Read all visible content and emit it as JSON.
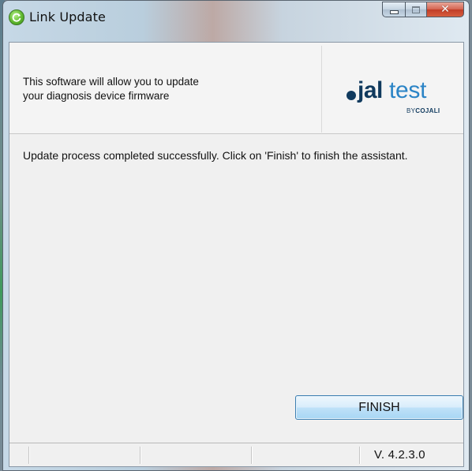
{
  "window": {
    "title": "Link Update",
    "controls": {
      "minimize": "minimize",
      "maximize": "maximize",
      "close": "close"
    }
  },
  "header": {
    "description_line1": "This software will allow you to update",
    "description_line2": "your diagnosis device firmware",
    "logo": {
      "text_bold": "jal",
      "text_light": "test",
      "sub_prefix": "BY",
      "sub_brand": "COJALI",
      "colors": {
        "dark": "#103a5e",
        "light": "#2b84c6"
      }
    }
  },
  "main": {
    "message": "Update process completed successfully. Click on 'Finish' to finish the assistant.",
    "finish_label": "FINISH"
  },
  "statusbar": {
    "version": "V. 4.2.3.0"
  },
  "icons": {
    "app": "refresh-icon",
    "minimize": "minimize-icon",
    "maximize": "maximize-icon",
    "close": "close-icon"
  },
  "colors": {
    "accent": "#3c7fb1",
    "close_button": "#c13e28",
    "app_icon": "#5fb82e"
  }
}
